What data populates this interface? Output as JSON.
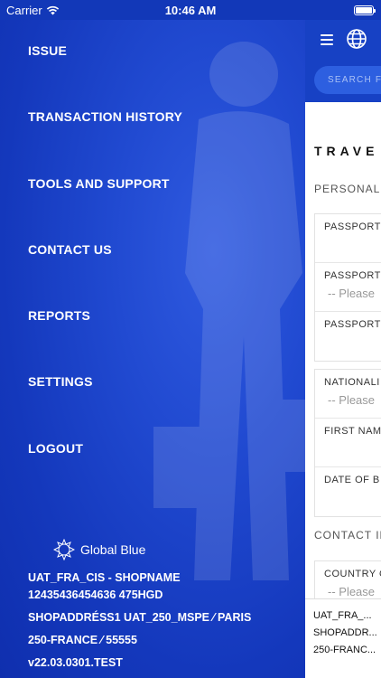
{
  "status_bar": {
    "carrier": "Carrier",
    "time": "10:46 AM"
  },
  "menu": {
    "items": [
      {
        "label": "ISSUE"
      },
      {
        "label": "TRANSACTION HISTORY"
      },
      {
        "label": "TOOLS AND SUPPORT"
      },
      {
        "label": "CONTACT US"
      },
      {
        "label": "REPORTS"
      },
      {
        "label": "SETTINGS"
      },
      {
        "label": "LOGOUT"
      }
    ]
  },
  "footer": {
    "brand": "Global Blue",
    "line1": "UAT_FRA_CIS - SHOPNAME",
    "line2": "12435436454636 475HGD",
    "line3": "SHOPADDRÉSS1 UAT_250_MSPE ⁄ PARIS",
    "line4": "250-FRANCE ⁄ 55555",
    "version": "v22.03.0301.TEST"
  },
  "content": {
    "search_placeholder": "SEARCH FO",
    "page_title": "TRAVE",
    "section_personal": "PERSONAL I",
    "section_contact": "CONTACT IN",
    "card1": [
      {
        "label": "PASSPORT",
        "value": ""
      },
      {
        "label": "PASSPORT",
        "value": "-- Please"
      },
      {
        "label": "PASSPORT",
        "value": ""
      }
    ],
    "card2": [
      {
        "label": "NATIONALI",
        "value": "-- Please"
      },
      {
        "label": "FIRST NAM",
        "value": ""
      },
      {
        "label": "DATE OF B",
        "value": ""
      }
    ],
    "card3": [
      {
        "label": "COUNTRY O",
        "value": "-- Please"
      }
    ],
    "bottom": {
      "line1": "UAT_FRA_...",
      "line2": "SHOPADDR...",
      "line3": "250-FRANC..."
    }
  },
  "colors": {
    "primary": "#1741c4",
    "drawer": "#1a44c8",
    "input_pill": "#2d5fe0"
  }
}
